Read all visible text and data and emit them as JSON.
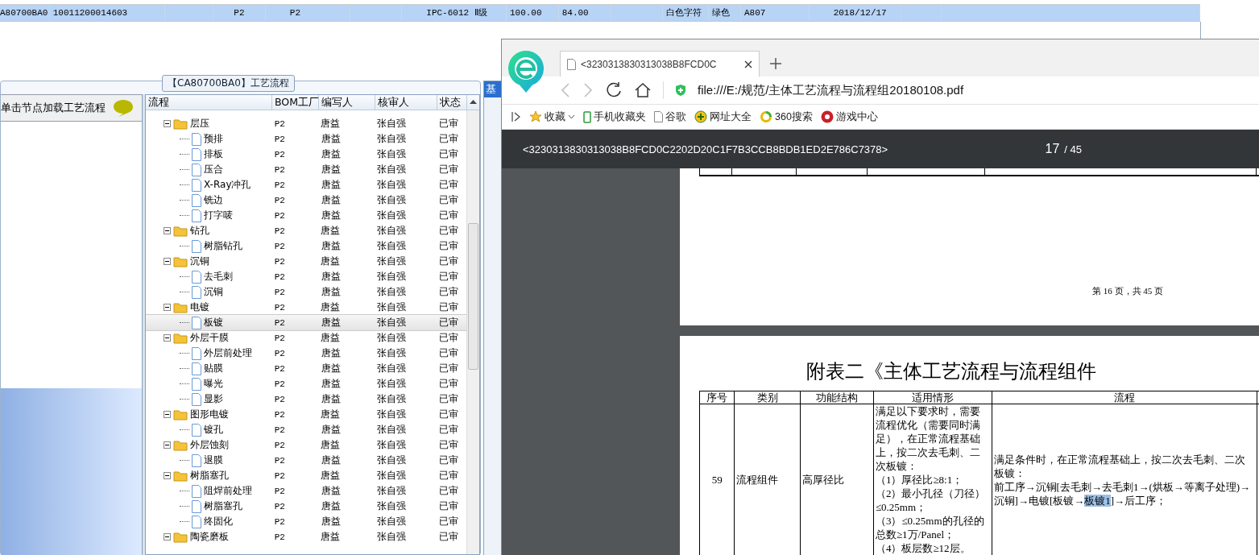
{
  "grid_row": {
    "selected": true,
    "cells": [
      "A80700BA0",
      "10011200014603",
      null,
      "P2",
      "P2",
      null,
      "IPC-6012 Ⅱ级",
      "100.00",
      "84.00",
      null,
      "白色字符",
      "绿色",
      "A807",
      "2018/12/17",
      null,
      null
    ]
  },
  "left_panel": {
    "hint": "单击节点加载工艺流程"
  },
  "group": {
    "title": "【CA80700BA0】工艺流程"
  },
  "tree": {
    "columns": [
      "流程",
      "BOM工厂",
      "编写人",
      "核审人",
      "状态"
    ],
    "nodes": [
      {
        "kind": "folder",
        "label": "层压",
        "expanded": true,
        "selected": false,
        "bom": "P2",
        "writer": "唐益",
        "reviewer": "张自强",
        "status": "已审",
        "children": [
          {
            "kind": "file",
            "label": "预排",
            "selected": false,
            "bom": "P2",
            "writer": "唐益",
            "reviewer": "张自强",
            "status": "已审"
          },
          {
            "kind": "file",
            "label": "排板",
            "selected": false,
            "bom": "P2",
            "writer": "唐益",
            "reviewer": "张自强",
            "status": "已审"
          },
          {
            "kind": "file",
            "label": "压合",
            "selected": false,
            "bom": "P2",
            "writer": "唐益",
            "reviewer": "张自强",
            "status": "已审"
          },
          {
            "kind": "file",
            "label": "X-Ray冲孔",
            "selected": false,
            "bom": "P2",
            "writer": "唐益",
            "reviewer": "张自强",
            "status": "已审"
          },
          {
            "kind": "file",
            "label": "铣边",
            "selected": false,
            "bom": "P2",
            "writer": "唐益",
            "reviewer": "张自强",
            "status": "已审"
          },
          {
            "kind": "file",
            "label": "打字唛",
            "selected": false,
            "bom": "P2",
            "writer": "唐益",
            "reviewer": "张自强",
            "status": "已审"
          }
        ]
      },
      {
        "kind": "folder",
        "label": "钻孔",
        "expanded": true,
        "selected": false,
        "bom": "P2",
        "writer": "唐益",
        "reviewer": "张自强",
        "status": "已审",
        "children": [
          {
            "kind": "file",
            "label": "树脂钻孔",
            "selected": false,
            "bom": "P2",
            "writer": "唐益",
            "reviewer": "张自强",
            "status": "已审"
          }
        ]
      },
      {
        "kind": "folder",
        "label": "沉铜",
        "expanded": true,
        "selected": false,
        "bom": "P2",
        "writer": "唐益",
        "reviewer": "张自强",
        "status": "已审",
        "children": [
          {
            "kind": "file",
            "label": "去毛刺",
            "selected": false,
            "bom": "P2",
            "writer": "唐益",
            "reviewer": "张自强",
            "status": "已审"
          },
          {
            "kind": "file",
            "label": "沉铜",
            "selected": false,
            "bom": "P2",
            "writer": "唐益",
            "reviewer": "张自强",
            "status": "已审"
          }
        ]
      },
      {
        "kind": "folder",
        "label": "电镀",
        "expanded": true,
        "selected": false,
        "bom": "P2",
        "writer": "唐益",
        "reviewer": "张自强",
        "status": "已审",
        "children": [
          {
            "kind": "file",
            "label": "板镀",
            "selected": true,
            "bom": "P2",
            "writer": "唐益",
            "reviewer": "张自强",
            "status": "已审"
          }
        ]
      },
      {
        "kind": "folder",
        "label": "外层干膜",
        "expanded": true,
        "selected": false,
        "bom": "P2",
        "writer": "唐益",
        "reviewer": "张自强",
        "status": "已审",
        "children": [
          {
            "kind": "file",
            "label": "外层前处理",
            "selected": false,
            "bom": "P2",
            "writer": "唐益",
            "reviewer": "张自强",
            "status": "已审"
          },
          {
            "kind": "file",
            "label": "贴膜",
            "selected": false,
            "bom": "P2",
            "writer": "唐益",
            "reviewer": "张自强",
            "status": "已审"
          },
          {
            "kind": "file",
            "label": "曝光",
            "selected": false,
            "bom": "P2",
            "writer": "唐益",
            "reviewer": "张自强",
            "status": "已审"
          },
          {
            "kind": "file",
            "label": "显影",
            "selected": false,
            "bom": "P2",
            "writer": "唐益",
            "reviewer": "张自强",
            "status": "已审"
          }
        ]
      },
      {
        "kind": "folder",
        "label": "图形电镀",
        "expanded": true,
        "selected": false,
        "bom": "P2",
        "writer": "唐益",
        "reviewer": "张自强",
        "status": "已审",
        "children": [
          {
            "kind": "file",
            "label": "镀孔",
            "selected": false,
            "bom": "P2",
            "writer": "唐益",
            "reviewer": "张自强",
            "status": "已审"
          }
        ]
      },
      {
        "kind": "folder",
        "label": "外层蚀刻",
        "expanded": true,
        "selected": false,
        "bom": "P2",
        "writer": "唐益",
        "reviewer": "张自强",
        "status": "已审",
        "children": [
          {
            "kind": "file",
            "label": "退膜",
            "selected": false,
            "bom": "P2",
            "writer": "唐益",
            "reviewer": "张自强",
            "status": "已审"
          }
        ]
      },
      {
        "kind": "folder",
        "label": "树脂塞孔",
        "expanded": true,
        "selected": false,
        "bom": "P2",
        "writer": "唐益",
        "reviewer": "张自强",
        "status": "已审",
        "children": [
          {
            "kind": "file",
            "label": "阻焊前处理",
            "selected": false,
            "bom": "P2",
            "writer": "唐益",
            "reviewer": "张自强",
            "status": "已审"
          },
          {
            "kind": "file",
            "label": "树脂塞孔",
            "selected": false,
            "bom": "P2",
            "writer": "唐益",
            "reviewer": "张自强",
            "status": "已审"
          },
          {
            "kind": "file",
            "label": "终固化",
            "selected": false,
            "bom": "P2",
            "writer": "唐益",
            "reviewer": "张自强",
            "status": "已审"
          }
        ]
      },
      {
        "kind": "folder",
        "label": "陶瓷磨板",
        "expanded": true,
        "selected": false,
        "bom": "P2",
        "writer": "唐益",
        "reviewer": "张自强",
        "status": "已审"
      }
    ]
  },
  "side_tab": {
    "label": "基"
  },
  "browser": {
    "tab_title": "<3230313830313038B8FCD0C",
    "url": "file:///E:/规范/主体工艺流程与流程组20180108.pdf",
    "bookmarks": [
      {
        "kind": "star",
        "label": "收藏"
      },
      {
        "kind": "phone",
        "label": "手机收藏夹"
      },
      {
        "kind": "page",
        "label": "谷歌"
      },
      {
        "kind": "plus",
        "label": "网址大全"
      },
      {
        "kind": "ring",
        "label": "360搜索"
      },
      {
        "kind": "game",
        "label": "游戏中心"
      }
    ],
    "pdf": {
      "title": "<3230313830313038B8FCD0C2202D20C1F7B3CCB8BDB1ED2E786C7378>",
      "page": "17",
      "total": "/ 45",
      "page_footer": "第 16 页，共 45 页",
      "heading": "附表二《主体工艺流程与流程组件",
      "columns": [
        "序号",
        "类别",
        "功能结构",
        "适用情形",
        "流程"
      ],
      "row": {
        "number": "59",
        "category": "流程组件",
        "structure": "高厚径比",
        "conditions": [
          "满足以下要求时，需要流程优化（需要同时满足），在正常流程基础上，按二次去毛刺、二次板镀：",
          "（1）厚径比≥8:1；",
          "（2）最小孔径（刀径）≤0.25mm；",
          "（3）≤0.25mm的孔径的总数≥1万/Panel；",
          "（4）板层数≥12层。"
        ],
        "flow_intro": "满足条件时，在正常流程基础上，按二次去毛刺、二次板镀：",
        "flow": [
          {
            "text": "前工序→沉铜[去毛刺→去毛刺1→(烘板→等离子处理)→沉铜]→电镀[板镀→",
            "highlighted": false
          },
          {
            "text": "板镀1",
            "highlighted": true
          },
          {
            "text": "]→后工序；",
            "highlighted": false
          }
        ]
      }
    }
  }
}
